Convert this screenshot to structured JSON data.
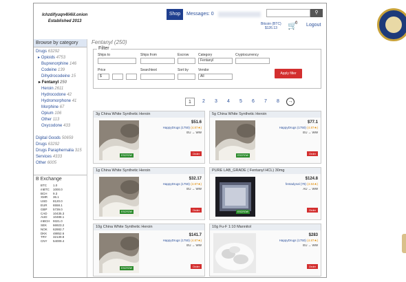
{
  "header": {
    "site_address": "lchzdifyuqn4li4iil.onion",
    "established": "Established 2013",
    "shop_label": "Shop",
    "messages_label": "Messages: 0",
    "search_placeholder": "",
    "search_icon": "search-icon",
    "btc_label": "Bitcoin (BTC)",
    "btc_amount": "$126.13",
    "cart_icon": "cart-icon",
    "cart_count": "0",
    "logout_label": "Logout"
  },
  "sidebar": {
    "heading": "Browse by category",
    "drugs": {
      "label": "Drugs",
      "count": "63292"
    },
    "opioids": {
      "label": "Opioids",
      "count": "4753"
    },
    "opioid_items": [
      {
        "label": "Buprenorphine",
        "count": "146"
      },
      {
        "label": "Codeine",
        "count": "139"
      },
      {
        "label": "Dihydrocodeine",
        "count": "15"
      },
      {
        "label": "Fentanyl",
        "count": "250"
      },
      {
        "label": "Heroin",
        "count": "2611"
      },
      {
        "label": "Hydrocodone",
        "count": "42"
      },
      {
        "label": "Hydromorphone",
        "count": "41"
      },
      {
        "label": "Morphine",
        "count": "67"
      },
      {
        "label": "Opium",
        "count": "106"
      },
      {
        "label": "Other",
        "count": "113"
      },
      {
        "label": "Oxycodone",
        "count": "433"
      }
    ],
    "other_categories": [
      {
        "label": "Digital Goods",
        "count": "50659"
      },
      {
        "label": "Drugs",
        "count": "63292"
      },
      {
        "label": "Drugs Paraphernalia",
        "count": "315"
      },
      {
        "label": "Services",
        "count": "4333"
      },
      {
        "label": "Other",
        "count": "6005"
      }
    ],
    "exchange_heading": "B Exchange",
    "exchange": [
      {
        "code": "BTC",
        "value": "1.0"
      },
      {
        "code": "mBTC",
        "value": "1000.0"
      },
      {
        "code": "BCH",
        "value": "9.3"
      },
      {
        "code": "XMR",
        "value": "36.1"
      },
      {
        "code": "USD",
        "value": "8120.0"
      },
      {
        "code": "EUR",
        "value": "6558.1"
      },
      {
        "code": "GBP",
        "value": "5739.0"
      },
      {
        "code": "CAD",
        "value": "10435.3"
      },
      {
        "code": "AUD",
        "value": "10488.1"
      },
      {
        "code": "mBCH",
        "value": "9321.0"
      },
      {
        "code": "SEK",
        "value": "66923.2"
      },
      {
        "code": "NOK",
        "value": "62882.7"
      },
      {
        "code": "DKK",
        "value": "48852.6"
      },
      {
        "code": "TRY",
        "value": "32139.8"
      },
      {
        "code": "CNY",
        "value": "54009.4"
      }
    ]
  },
  "main": {
    "title": "Fentanyl (250)",
    "filter": {
      "legend": "Filter",
      "ships_to": "Ships to",
      "ships_from": "Ships from",
      "escrow": "Escrow",
      "category": "Category",
      "category_value": "Fentanyl",
      "cryptocurrency": "Cryptocurrency",
      "price": "Price",
      "price_currency": "$",
      "searchtext": "Searchtext",
      "sort_by": "Sort by",
      "vendor": "Vendor",
      "vendor_value": "All",
      "apply_label": "Apply filter"
    },
    "pagination": [
      "1",
      "2",
      "3",
      "4",
      "5",
      "6",
      "7",
      "8"
    ],
    "listings": [
      {
        "title": "3g China White Synthetic Heroin",
        "price": "$51.6",
        "seller": "HappyDrugs (1750)",
        "rating": "(4.87★)",
        "ship": "EU → WW",
        "escrow": "ESCROW",
        "order": "Order"
      },
      {
        "title": "5g China White Synthetic Heroin",
        "price": "$77.1",
        "seller": "HappyDrugs (1750)",
        "rating": "(4.87★)",
        "ship": "EU → WW",
        "escrow": "ESCROW",
        "order": "Order"
      },
      {
        "title": "1g China White Synthetic Heroin",
        "price": "$32.17",
        "seller": "HappyDrugs (1750)",
        "rating": "(4.87★)",
        "ship": "EU → WW",
        "escrow": "ESCROW",
        "order": "Order"
      },
      {
        "title": "PURE LAB_GRADE ( Fentanyl HCL) 30mg",
        "price": "$124.8",
        "seller": "fentadynal (79)",
        "rating": "(4.84★)",
        "ship": "AU → WW",
        "escrow": "ESCROW",
        "order": "Order"
      },
      {
        "title": "10g China White Synthetic Heroin",
        "price": "$141.7",
        "seller": "HappyDrugs (1750)",
        "rating": "(4.87★)",
        "ship": "EU → WW",
        "escrow": "ESCROW",
        "order": "Order"
      },
      {
        "title": "10g Fu-F 1:10 Mannitol",
        "price": "$283",
        "seller": "HappyDrugs (1750)",
        "rating": "(4.87★)",
        "ship": "EU → WW",
        "escrow": "",
        "order": "Order"
      }
    ]
  },
  "colors": {
    "shop_bg": "#1f3f8f",
    "link": "#2a4f9a",
    "apply_bg": "#d32f2f",
    "escrow_bg": "#2a8a2a"
  }
}
